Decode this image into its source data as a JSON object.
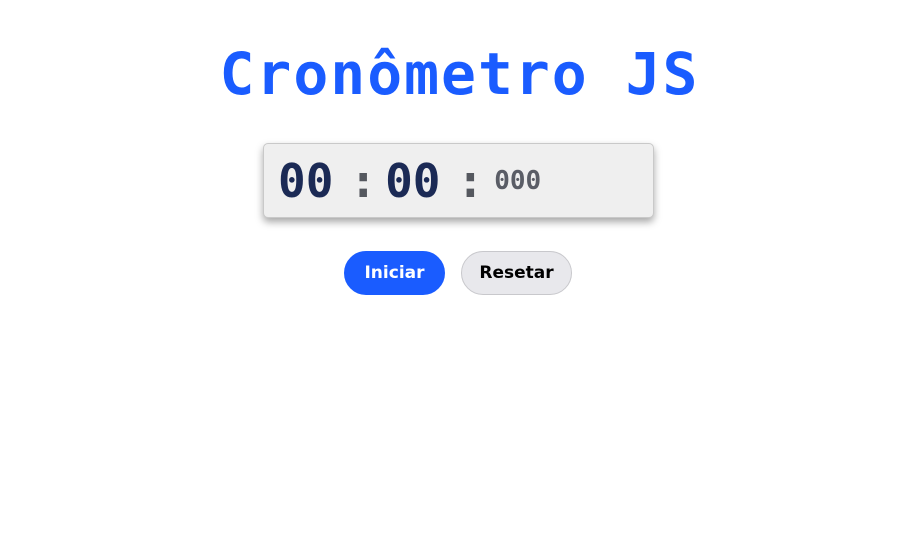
{
  "title": "Cronômetro JS",
  "timer": {
    "minutes": "00",
    "separator1": ":",
    "seconds": "00",
    "separator2": ":",
    "milliseconds": "000"
  },
  "buttons": {
    "start_label": "Iniciar",
    "reset_label": "Resetar"
  },
  "colors": {
    "accent": "#1a5cff",
    "digits": "#1b2a55",
    "reset_bg": "#e8e8ec"
  }
}
